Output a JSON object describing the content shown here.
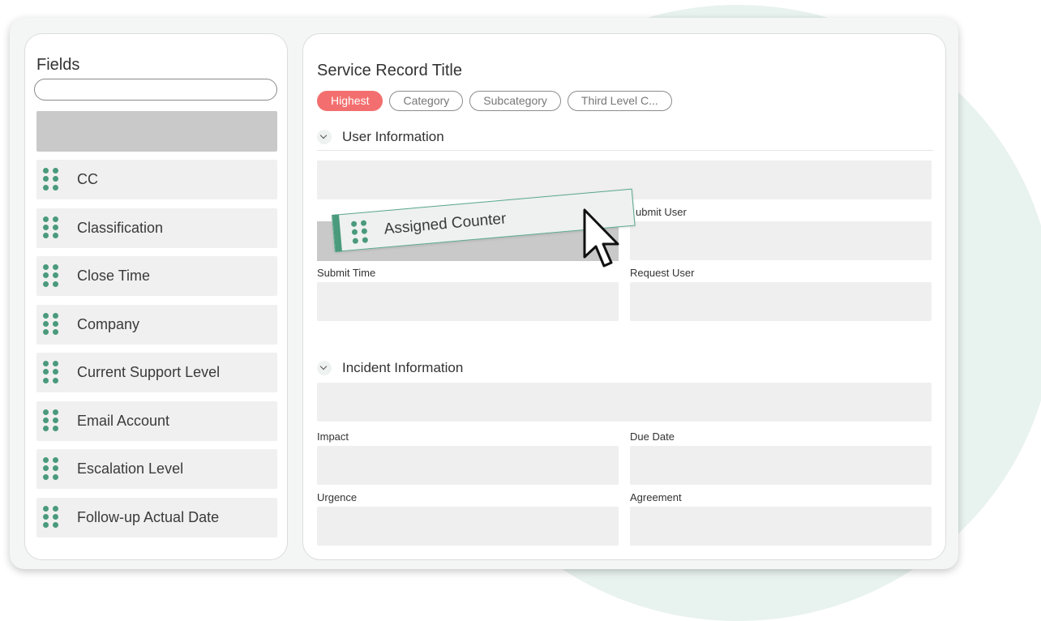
{
  "fields_panel": {
    "title": "Fields",
    "search_placeholder": "",
    "items": [
      {
        "label": "CC"
      },
      {
        "label": "Classification"
      },
      {
        "label": "Close Time"
      },
      {
        "label": "Company"
      },
      {
        "label": "Current Support Level"
      },
      {
        "label": "Email Account"
      },
      {
        "label": "Escalation Level"
      },
      {
        "label": "Follow-up Actual Date"
      }
    ]
  },
  "form": {
    "title": "Service Record Title",
    "tags": [
      {
        "label": "Highest",
        "active": true
      },
      {
        "label": "Category",
        "active": false
      },
      {
        "label": "Subcategory",
        "active": false
      },
      {
        "label": "Third Level C...",
        "active": false
      }
    ],
    "sections": {
      "user_info": {
        "title": "User Information",
        "labels": {
          "submit_user": "ubmit User",
          "submit_time": "Submit Time",
          "request_user": "Request User"
        }
      },
      "incident_info": {
        "title": "Incident Information",
        "labels": {
          "impact": "Impact",
          "due_date": "Due Date",
          "urgence": "Urgence",
          "agreement": "Agreement"
        }
      }
    }
  },
  "drag_card": {
    "label": "Assigned Counter"
  },
  "colors": {
    "accent": "#4a9a7c",
    "tag_active": "#f36f6f",
    "background_blob": "#e8f2ee"
  }
}
